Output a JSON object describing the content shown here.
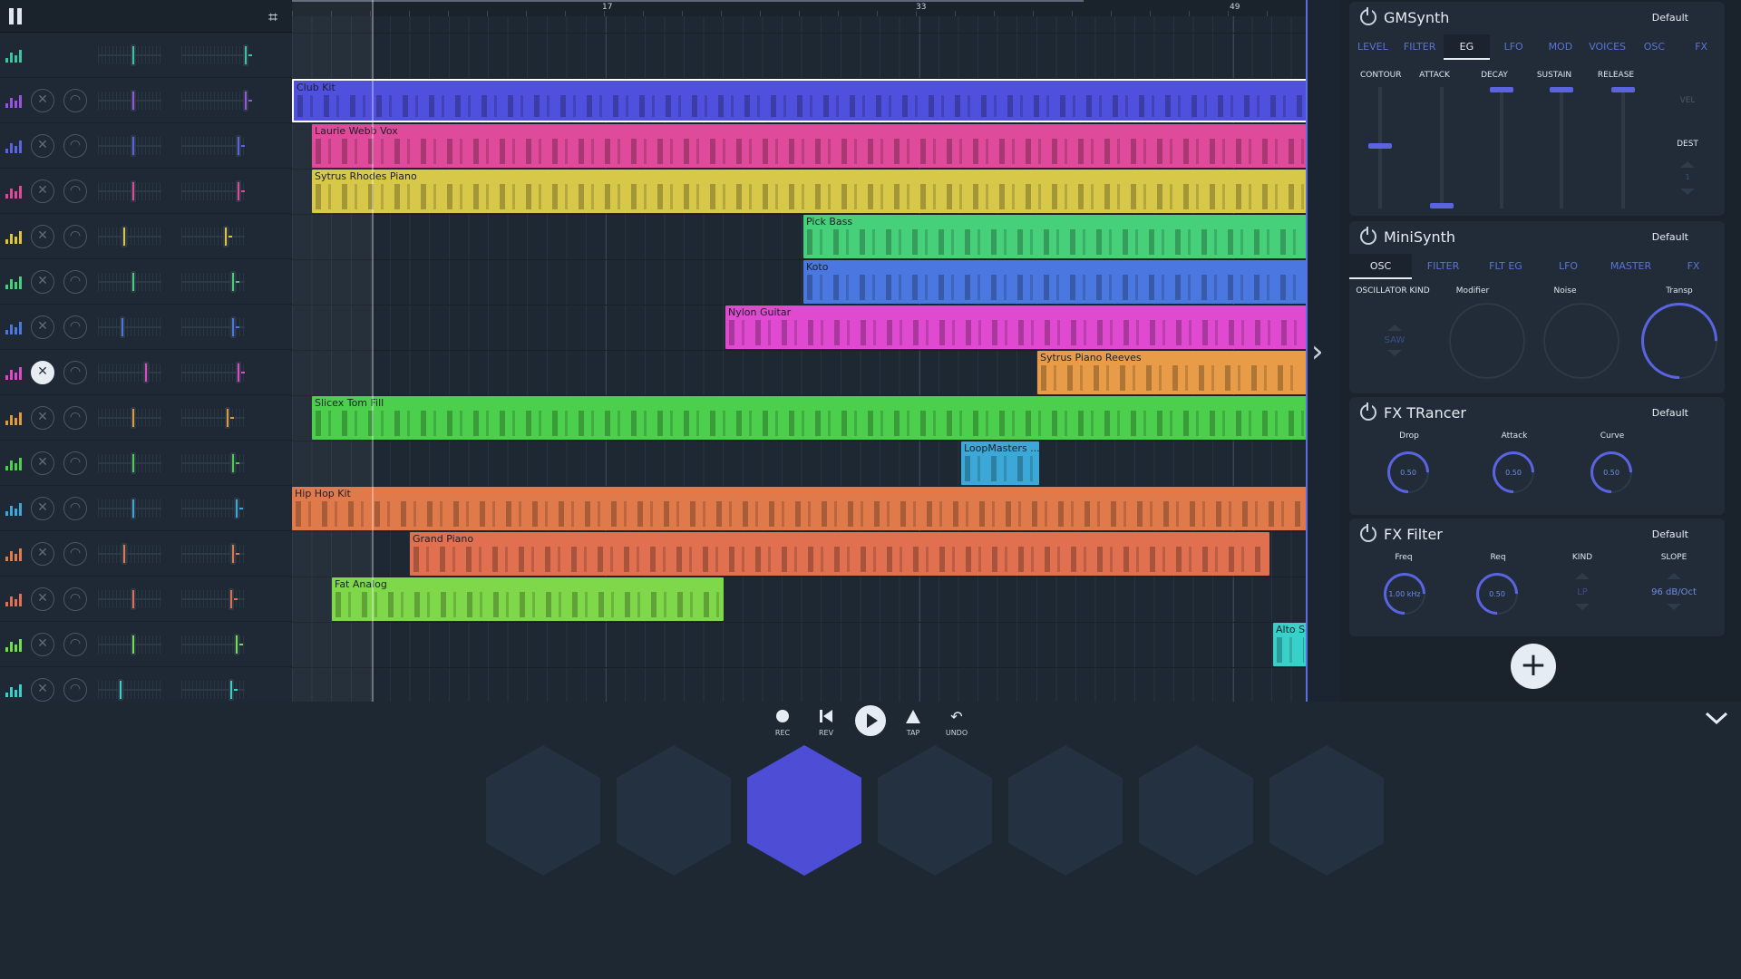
{
  "ruler": {
    "bars": [
      "17",
      "33",
      "49"
    ]
  },
  "tracks": [
    {
      "color": "#3cc4a0",
      "muted": false
    },
    {
      "color": "#9a52e0",
      "muted": false
    },
    {
      "color": "#5a63e0",
      "muted": false
    },
    {
      "color": "#e0489a",
      "muted": false
    },
    {
      "color": "#e0c43c",
      "muted": false
    },
    {
      "color": "#46d07a",
      "muted": false
    },
    {
      "color": "#4a78e0",
      "muted": false
    },
    {
      "color": "#e048c8",
      "muted": true
    },
    {
      "color": "#e09a3c",
      "muted": false
    },
    {
      "color": "#4ccf4c",
      "muted": false
    },
    {
      "color": "#3ca8d8",
      "muted": false
    },
    {
      "color": "#e07a4a",
      "muted": false
    },
    {
      "color": "#e07050",
      "muted": false
    },
    {
      "color": "#6fe04c",
      "muted": false
    },
    {
      "color": "#38d0c8",
      "muted": false
    }
  ],
  "clips": [
    {
      "name": "Club Kit",
      "color": "#5050de"
    },
    {
      "name": "Laurie Webb Vox",
      "color": "#e04a9a"
    },
    {
      "name": "Sytrus Rhodes Piano",
      "color": "#d8c84a"
    },
    {
      "name": "Pick Bass",
      "color": "#46d07a"
    },
    {
      "name": "Koto",
      "color": "#4a78e0"
    },
    {
      "name": "Nylon Guitar",
      "color": "#e04ad0"
    },
    {
      "name": "Sytrus Piano Reeves",
      "color": "#e89c48"
    },
    {
      "name": "Slicex Tom Fill",
      "color": "#4ccf4c"
    },
    {
      "name": "LoopMasters ...",
      "color": "#3ca8d8"
    },
    {
      "name": "Hip Hop Kit",
      "color": "#e07a4a"
    },
    {
      "name": "Grand Piano",
      "color": "#e07050"
    },
    {
      "name": "Fat Analog",
      "color": "#7fd84a"
    },
    {
      "name": "Alto S...",
      "color": "#38d0c8"
    }
  ],
  "gmsynth": {
    "title": "GMSynth",
    "preset": "Default",
    "tabs": [
      "LEVEL",
      "FILTER",
      "EG",
      "LFO",
      "MOD",
      "VOICES",
      "OSC",
      "FX"
    ],
    "active_tab": "EG",
    "params": [
      "CONTOUR",
      "ATTACK",
      "DECAY",
      "SUSTAIN",
      "RELEASE"
    ],
    "vel": "VEL",
    "dest": "DEST",
    "dest_value": "1"
  },
  "minisynth": {
    "title": "MiniSynth",
    "preset": "Default",
    "tabs": [
      "OSC",
      "FILTER",
      "FLT EG",
      "LFO",
      "MASTER",
      "FX"
    ],
    "active_tab": "OSC",
    "osc_kind_label": "OSCILLATOR KIND",
    "osc_kind_value": "SAW",
    "modifier": "Modifier",
    "noise": "Noise",
    "transp": "Transp"
  },
  "fxtrancer": {
    "title": "FX TRancer",
    "preset": "Default",
    "params": [
      {
        "label": "Drop",
        "value": "0.50"
      },
      {
        "label": "Attack",
        "value": "0.50"
      },
      {
        "label": "Curve",
        "value": "0.50"
      }
    ]
  },
  "fxfilter": {
    "title": "FX Filter",
    "preset": "Default",
    "freq_label": "Freq",
    "freq_value": "1.00 kHz",
    "req_label": "Req",
    "req_value": "0.50",
    "kind_label": "KIND",
    "kind_value": "LP",
    "slope_label": "SLOPE",
    "slope_value": "96 dB/Oct"
  },
  "transport": {
    "rec": "REC",
    "rev": "REV",
    "tap": "TAP",
    "undo": "UNDO"
  },
  "pads": {
    "active_index": 2,
    "active_color": "#4d4dd6"
  },
  "accent": "#5a63e0"
}
